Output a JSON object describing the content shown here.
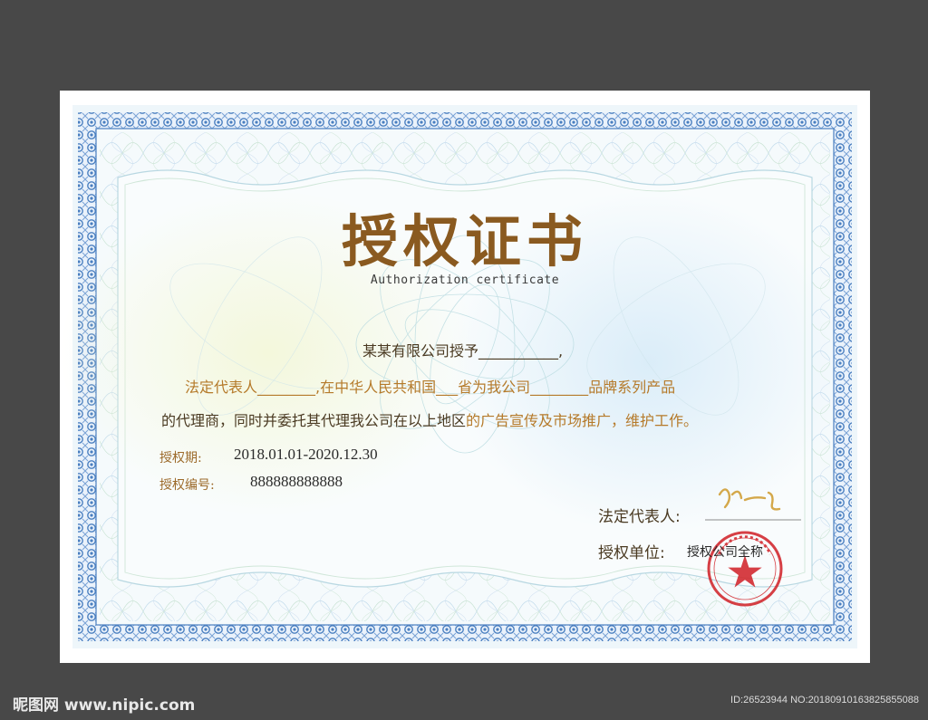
{
  "certificate": {
    "title": "授权证书",
    "subtitle": "Authorization certificate",
    "line1": "某某有限公司授予___________,",
    "line2_prefix": "法定代表人________,在中华人民共和国___省为我公司________",
    "line2_suffix": "品牌系列产品",
    "line3_a": "的代理商，同时并委托其代理我公司在以上地区",
    "line3_b": "的广告宣传及市场推广，维护工作。",
    "period_label": "授权期:",
    "period_value": "2018.01.01-2020.12.30",
    "number_label": "授权编号:",
    "number_value": "888888888888",
    "rep_label": "法定代表人:",
    "unit_label": "授权单位:",
    "unit_value": "授权公司全称"
  },
  "watermark": {
    "site": "昵图网 www.nipic.com",
    "id_text": "ID:26523944 NO:20180910163825855088"
  },
  "colors": {
    "background": "#484848",
    "border": "#4a7fc0",
    "title": "#8a5a20",
    "gold_text": "#b57a2a",
    "seal": "#d01f25"
  }
}
